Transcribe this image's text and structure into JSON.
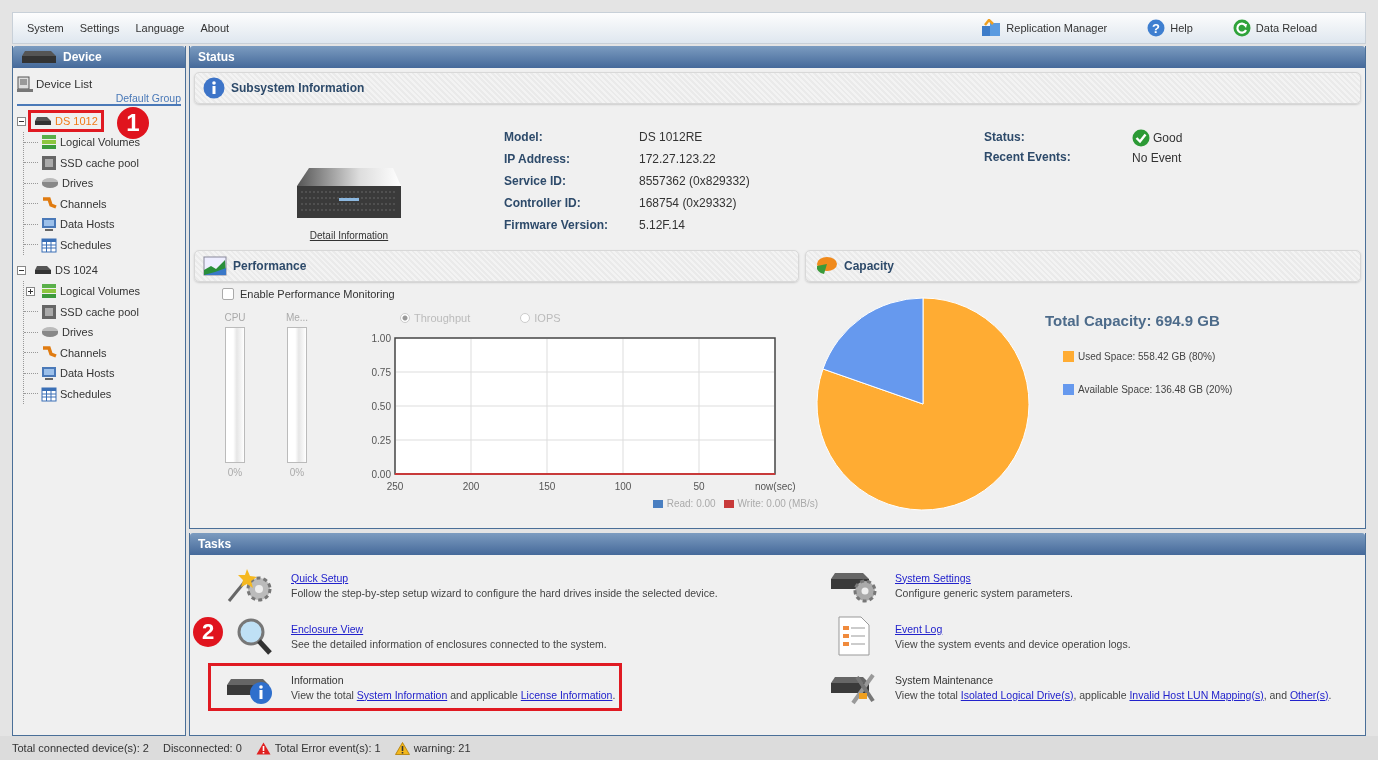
{
  "menu": [
    {
      "label": "System"
    },
    {
      "label": "Settings"
    },
    {
      "label": "Language"
    },
    {
      "label": "About"
    }
  ],
  "tools": [
    {
      "label": "Replication Manager",
      "kind": "replication"
    },
    {
      "label": "Help",
      "kind": "help",
      "glyph": "?"
    },
    {
      "label": "Data Reload",
      "kind": "reload"
    }
  ],
  "sidebar": {
    "title": "Device",
    "list_label": "Device List",
    "group_label": "Default Group",
    "devices": [
      {
        "label": "DS 1012",
        "selected": true,
        "expanded": true,
        "highlighted": true,
        "callout": "1",
        "children": [
          {
            "label": "Logical Volumes",
            "kind": "volumes"
          },
          {
            "label": "SSD cache pool",
            "kind": "ssd"
          },
          {
            "label": "Drives",
            "kind": "drives"
          },
          {
            "label": "Channels",
            "kind": "channels"
          },
          {
            "label": "Data Hosts",
            "kind": "hosts"
          },
          {
            "label": "Schedules",
            "kind": "schedules"
          }
        ]
      },
      {
        "label": "DS 1024",
        "selected": false,
        "expanded": true,
        "highlighted": false,
        "children": [
          {
            "label": "Logical Volumes",
            "kind": "volumes",
            "expanded": false
          },
          {
            "label": "SSD cache pool",
            "kind": "ssd"
          },
          {
            "label": "Drives",
            "kind": "drives"
          },
          {
            "label": "Channels",
            "kind": "channels"
          },
          {
            "label": "Data Hosts",
            "kind": "hosts"
          },
          {
            "label": "Schedules",
            "kind": "schedules"
          }
        ]
      }
    ]
  },
  "status": {
    "title": "Status",
    "subsystem": {
      "title": "Subsystem Information",
      "detail_link": "Detail Information",
      "fields": [
        {
          "label": "Model:",
          "value": "DS 1012RE"
        },
        {
          "label": "IP Address:",
          "value": "172.27.123.22"
        },
        {
          "label": "Service ID:",
          "value": "8557362 (0x829332)"
        },
        {
          "label": "Controller ID:",
          "value": "168754 (0x29332)"
        },
        {
          "label": "Firmware Version:",
          "value": "5.12F.14"
        }
      ],
      "state": [
        {
          "label": "Status:",
          "value": "Good",
          "kind": "good"
        },
        {
          "label": "Recent Events:",
          "value": "No Event",
          "kind": "plain"
        }
      ]
    },
    "performance": {
      "title": "Performance",
      "monitoring": {
        "label": "Enable Performance Monitoring",
        "checked": false
      },
      "meters": [
        {
          "label": "CPU",
          "level": 0,
          "reading": "0%"
        },
        {
          "label": "Me...",
          "level": 0,
          "reading": "0%"
        }
      ],
      "modes": [
        {
          "label": "Throughput",
          "selected": true,
          "disabled": true
        },
        {
          "label": "IOPS",
          "selected": false,
          "disabled": true
        }
      ],
      "chart_data": {
        "type": "line",
        "grid": true,
        "categories": [
          "250",
          "200",
          "150",
          "100",
          "50",
          "now(sec)"
        ],
        "ylim": [
          0,
          1
        ],
        "yticks": [
          {
            "value": 0,
            "label": "0.00"
          },
          {
            "value": 0.25,
            "label": "0.25"
          },
          {
            "value": 0.5,
            "label": "0.50"
          },
          {
            "value": 0.75,
            "label": "0.75"
          },
          {
            "value": 1,
            "label": "1.00"
          }
        ],
        "series": [
          {
            "name": "Read: 0.00",
            "color": "#4a7fc1",
            "values": [
              null,
              null,
              null,
              null,
              null,
              null
            ]
          },
          {
            "name": "Write: 0.00 (MB/s)",
            "color": "#c83a3a",
            "values": [
              0,
              0,
              0,
              0,
              0,
              0
            ]
          }
        ]
      }
    },
    "capacity": {
      "title": "Capacity",
      "total": "Total Capacity: 694.9 GB",
      "chart_data": {
        "type": "pie",
        "categories": [
          "Used Space: 558.42 GB (80%)",
          "Available Space: 136.48 GB (20%)"
        ],
        "values": [
          558.42,
          136.48
        ],
        "colors": [
          "#ffac33",
          "#6699ee"
        ]
      }
    }
  },
  "tasks": {
    "title": "Tasks",
    "columns": [
      [
        {
          "kind": "wizard",
          "title": "Quick Setup",
          "link": true,
          "highlighted": false,
          "description": [
            {
              "text": "Follow the step-by-step setup wizard to configure the hard drives inside the selected device.",
              "link": false
            }
          ]
        },
        {
          "kind": "search",
          "title": "Enclosure View",
          "link": true,
          "highlighted": false,
          "callout": "2",
          "description": [
            {
              "text": "See the detailed information of enclosures connected to the system.",
              "link": false
            }
          ]
        },
        {
          "kind": "info",
          "title": "Information",
          "link": false,
          "highlighted": true,
          "description": [
            {
              "text": "View the total ",
              "link": false
            },
            {
              "text": "System Information",
              "link": true
            },
            {
              "text": " and applicable ",
              "link": false
            },
            {
              "text": "License Information",
              "link": true
            },
            {
              "text": ".",
              "link": false
            }
          ]
        }
      ],
      [
        {
          "kind": "settings",
          "title": "System Settings",
          "link": true,
          "highlighted": false,
          "description": [
            {
              "text": "Configure generic system parameters.",
              "link": false
            }
          ]
        },
        {
          "kind": "log",
          "title": "Event Log",
          "link": true,
          "highlighted": false,
          "description": [
            {
              "text": "View the system events and device operation logs.",
              "link": false
            }
          ]
        },
        {
          "kind": "maintenance",
          "title": "System Maintenance",
          "link": false,
          "highlighted": false,
          "description": [
            {
              "text": "View the total ",
              "link": false
            },
            {
              "text": "Isolated Logical Drive(s)",
              "link": true
            },
            {
              "text": ", applicable ",
              "link": false
            },
            {
              "text": "Invalid Host LUN Mapping(s)",
              "link": true
            },
            {
              "text": ", and ",
              "link": false
            },
            {
              "text": "Other(s)",
              "link": true
            },
            {
              "text": ".",
              "link": false
            }
          ]
        }
      ]
    ]
  },
  "status_bar": [
    {
      "text": "Total connected device(s): 2",
      "kind": "plain"
    },
    {
      "text": "Disconnected: 0",
      "kind": "plain"
    },
    {
      "text": "Total Error event(s): 1",
      "kind": "error"
    },
    {
      "text": "warning: 21",
      "kind": "warning"
    }
  ]
}
